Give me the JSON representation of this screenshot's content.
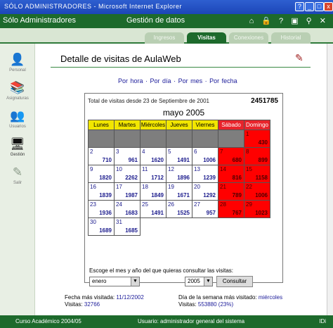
{
  "window": {
    "title": "SÓLO ADMINISTRADORES - Microsoft Internet Explorer",
    "controls": [
      "?",
      "_",
      "□",
      "x"
    ]
  },
  "header": {
    "site": "Sólo Administradores",
    "section": "Gestión de datos",
    "icons": [
      "home-icon",
      "lock-icon",
      "help-icon",
      "folder-icon",
      "search-icon",
      "close-icon"
    ],
    "icon_glyphs": "⌂ 🔒 ? ▣ ⚲ ✕"
  },
  "tabs": [
    {
      "label": "Ingresos",
      "active": false
    },
    {
      "label": "Visitas",
      "active": true
    },
    {
      "label": "Conexiones",
      "active": false
    },
    {
      "label": "Historial",
      "active": false
    }
  ],
  "sidebar": {
    "items": [
      {
        "label": "Personal",
        "icon": "person-icon",
        "glyph": "👤",
        "selected": false
      },
      {
        "label": "Asignaturas",
        "icon": "books-icon",
        "glyph": "📚",
        "selected": false
      },
      {
        "label": "Usuarios",
        "icon": "users-icon",
        "glyph": "👥",
        "selected": false
      },
      {
        "label": "Gestión",
        "icon": "monitor-icon",
        "glyph": "🖥",
        "selected": true
      },
      {
        "label": "Salir",
        "icon": "exit-icon",
        "glyph": "✎",
        "selected": false
      }
    ]
  },
  "main": {
    "title": "Detalle de visitas de AulaWeb",
    "links": [
      "Por hora",
      "Por día",
      "Por mes",
      "Por fecha"
    ],
    "total_label": "Total de visitas desde 23 de Septiembre de 2001",
    "total_value": "2451785",
    "month_title": "mayo 2005",
    "weekdays": [
      "Lunes",
      "Martes",
      "Miércoles",
      "Jueves",
      "Viernes",
      "Sábado",
      "Domingo"
    ],
    "weeks": [
      [
        {
          "day": "",
          "value": ""
        },
        {
          "day": "",
          "value": ""
        },
        {
          "day": "",
          "value": ""
        },
        {
          "day": "",
          "value": ""
        },
        {
          "day": "",
          "value": ""
        },
        {
          "day": "",
          "value": ""
        },
        {
          "day": "1",
          "value": "430"
        }
      ],
      [
        {
          "day": "2",
          "value": "710"
        },
        {
          "day": "3",
          "value": "961"
        },
        {
          "day": "4",
          "value": "1620"
        },
        {
          "day": "5",
          "value": "1491"
        },
        {
          "day": "6",
          "value": "1006"
        },
        {
          "day": "7",
          "value": "680"
        },
        {
          "day": "8",
          "value": "899"
        }
      ],
      [
        {
          "day": "9",
          "value": "1820"
        },
        {
          "day": "10",
          "value": "2262"
        },
        {
          "day": "11",
          "value": "1712"
        },
        {
          "day": "12",
          "value": "1896"
        },
        {
          "day": "13",
          "value": "1239"
        },
        {
          "day": "14",
          "value": "816"
        },
        {
          "day": "15",
          "value": "1158"
        }
      ],
      [
        {
          "day": "16",
          "value": "1839"
        },
        {
          "day": "17",
          "value": "1987"
        },
        {
          "day": "18",
          "value": "1849"
        },
        {
          "day": "19",
          "value": "1671"
        },
        {
          "day": "20",
          "value": "1292"
        },
        {
          "day": "21",
          "value": "789"
        },
        {
          "day": "22",
          "value": "1006"
        }
      ],
      [
        {
          "day": "23",
          "value": "1936"
        },
        {
          "day": "24",
          "value": "1683"
        },
        {
          "day": "25",
          "value": "1491"
        },
        {
          "day": "26",
          "value": "1525"
        },
        {
          "day": "27",
          "value": "957"
        },
        {
          "day": "28",
          "value": "767"
        },
        {
          "day": "29",
          "value": "1023"
        }
      ],
      [
        {
          "day": "30",
          "value": "1689"
        },
        {
          "day": "31",
          "value": "1685"
        }
      ]
    ],
    "colors": {
      "weekday_header": "#f2e600",
      "weekend_header": "#e8232b",
      "weekend_cell": "#ff0000",
      "empty_cell": "#7e7e7e"
    },
    "prompt": "Escoge el mes y año del que quieras consultar las visitas:",
    "month_select": "enero",
    "year_select": "2005",
    "consult_button": "Consultar",
    "max_date_label": "Fecha más visitada:",
    "max_date_value": "11/12/2002",
    "max_visits_label": "Visitas:",
    "max_visits_value": "32766",
    "max_weekday_label": "Día de la semana más visitado:",
    "max_weekday_value": "miércoles",
    "weekday_visits_label": "Visitas:",
    "weekday_visits_value": "553880 (23%)"
  },
  "statusbar": {
    "course": "Curso Académico 2004/05",
    "user": "Usuario: administrador general del sistema",
    "lang": "IDi"
  }
}
